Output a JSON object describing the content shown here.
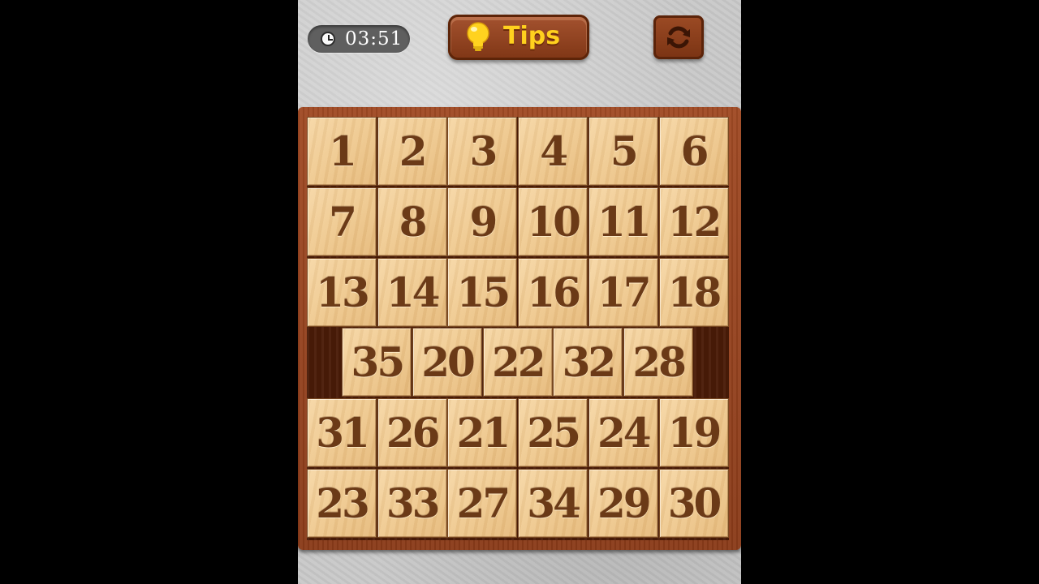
{
  "header": {
    "timer": {
      "icon": "clock-icon",
      "text": "03:51"
    },
    "tips_button": {
      "icon": "lightbulb-icon",
      "label": "Tips"
    },
    "restart_button": {
      "icon": "refresh-icon"
    }
  },
  "board": {
    "rows": [
      [
        "1",
        "2",
        "3",
        "4",
        "5",
        "6"
      ],
      [
        "7",
        "8",
        "9",
        "10",
        "11",
        "12"
      ],
      [
        "13",
        "14",
        "15",
        "16",
        "17",
        "18"
      ],
      [
        "35",
        "20",
        "22",
        "32",
        "28"
      ],
      [
        "31",
        "26",
        "21",
        "25",
        "24",
        "19"
      ],
      [
        "23",
        "33",
        "27",
        "34",
        "29",
        "30"
      ]
    ],
    "colors": {
      "frame": "#8a3b19",
      "tile": "#efc98f",
      "number": "#6b3a17",
      "slot": "#4a1b07"
    }
  }
}
